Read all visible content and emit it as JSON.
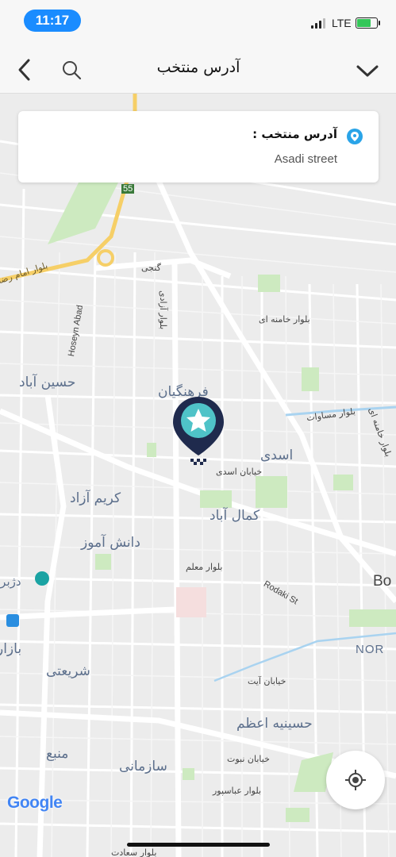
{
  "status": {
    "time": "11:17",
    "network": "LTE"
  },
  "header": {
    "title": "آدرس منتخب"
  },
  "card": {
    "title": "آدرس منتخب :",
    "value": "Asadi street"
  },
  "map": {
    "labels": {
      "ganji": "گنجی",
      "imam_reza": "بلوار امام رضا",
      "hoseyn_abad_en": "Hoseyn Abad",
      "azadi": "بلوار آزادی",
      "khameneh": "بلوار خامنه ای",
      "hoseyn_abad_fa": "حسین آباد",
      "farhangian": "فرهنگیان",
      "mosavat": "بلوار مساوات",
      "khameneh_2": "بلوار خامنه ای",
      "asadi": "اسدی",
      "asadi_st": "خیابان اسدی",
      "karim_azad": "کریم آزاد",
      "kamal_abad": "کمال آباد",
      "danesh_amooz": "دانش آموز",
      "moallem": "بلوار معلم",
      "dezh_bara": "دژبرا",
      "rudaki": "Rodaki St",
      "bo": "Bo",
      "bazar": "بازار",
      "nort": "NOR",
      "shariati": "شریعتی",
      "ayat": "خیابان آیت",
      "hoseynieh": "حسینیه اعظم",
      "manba": "منبع",
      "nabovat": "خیابان نبوت",
      "sazmani": "سازمانی",
      "abbaspour": "بلوار عباسپور",
      "saadat": "بلوار سعادت",
      "road_55": "55"
    }
  },
  "attribution": {
    "brand": "Google"
  },
  "icons": {
    "back": "chevron-left-icon",
    "search": "search-icon",
    "collapse": "chevron-down-icon",
    "pin": "location-pin-icon",
    "marker": "star-marker-icon",
    "locate": "my-location-icon"
  },
  "colors": {
    "accent": "#1a8cff",
    "marker": "#1f2a4d",
    "marker_inner": "#4fc3c8",
    "map_bg": "#ececec"
  }
}
